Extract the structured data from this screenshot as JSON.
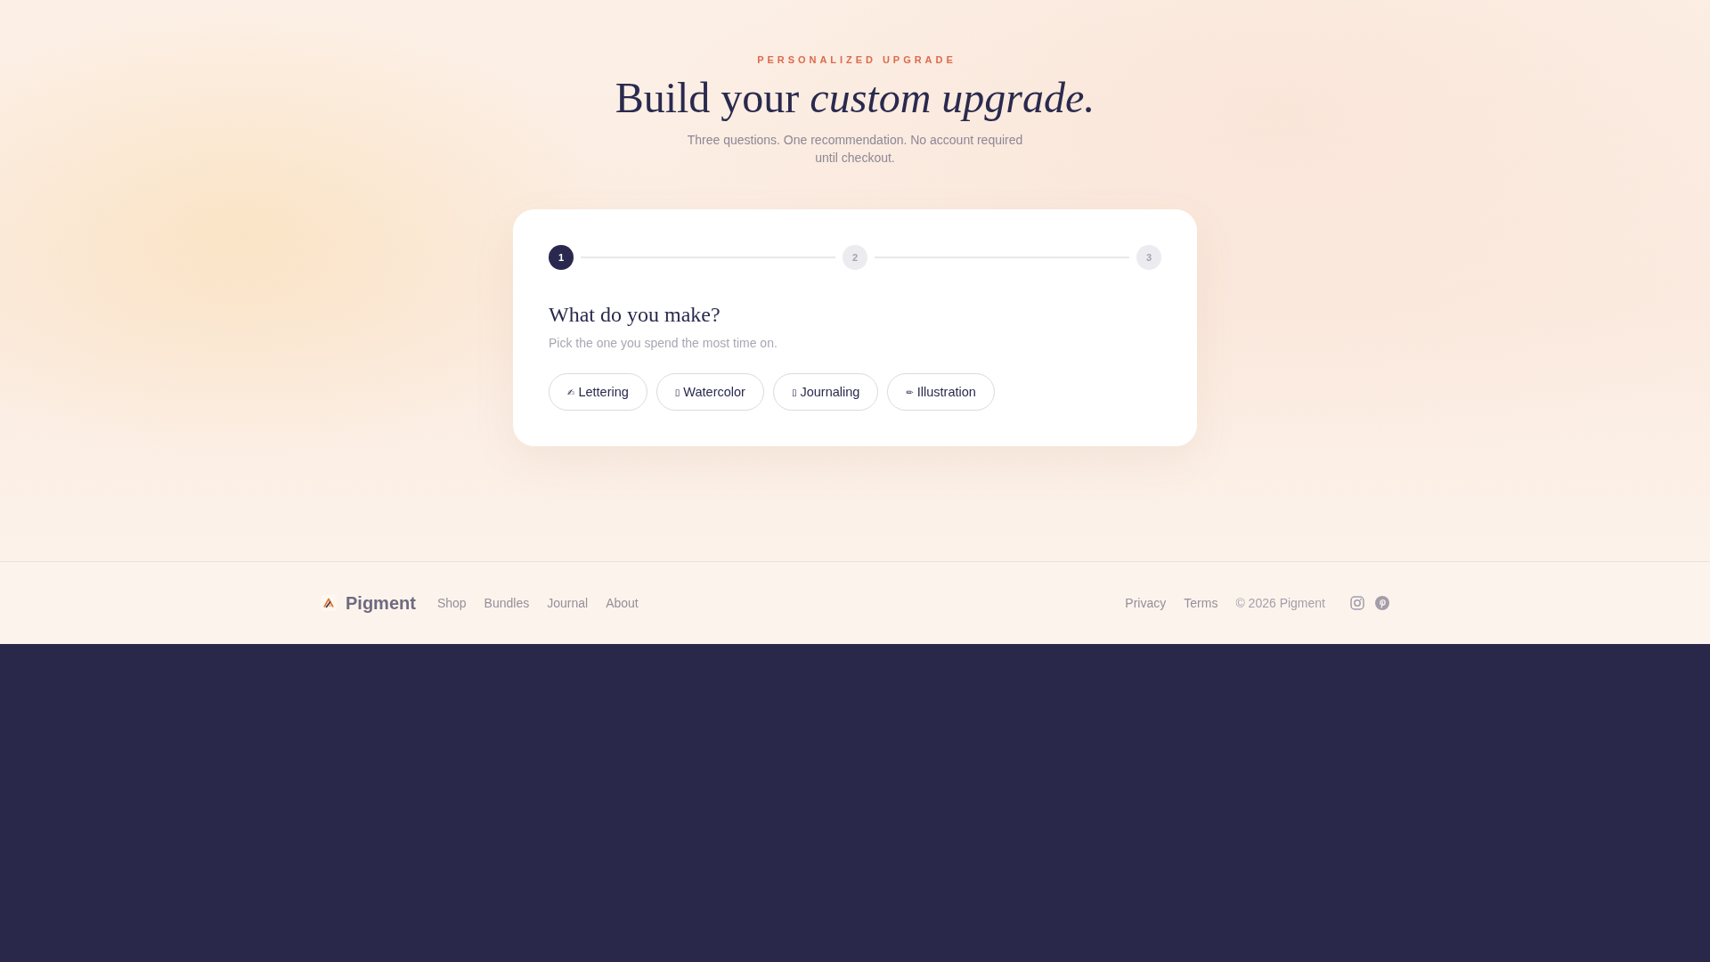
{
  "hero": {
    "eyebrow": "PERSONALIZED UPGRADE",
    "title": "Build your *custom upgrade.*",
    "subtitle": "Three questions. One recommendation. No account required until checkout."
  },
  "quiz": {
    "steps": [
      {
        "label": "1",
        "selected": true
      },
      {
        "label": "2",
        "selected": false
      },
      {
        "label": "3",
        "selected": false
      }
    ],
    "question": "What do you make?",
    "hint": "Pick the one you spend the most time on.",
    "options": [
      {
        "icon": "✍",
        "label": "Lettering",
        "selected": false
      },
      {
        "icon": "▯",
        "label": "Watercolor",
        "selected": false
      },
      {
        "icon": "▯",
        "label": "Journaling",
        "selected": false
      },
      {
        "icon": "✏",
        "label": "Illustration",
        "selected": false
      }
    ]
  },
  "footer": {
    "brand": "Pigment",
    "links": [
      "Shop",
      "Bundles",
      "Journal",
      "About"
    ],
    "legal_links": [
      "Privacy",
      "Terms"
    ],
    "copyright": "© 2026 Pigment"
  }
}
